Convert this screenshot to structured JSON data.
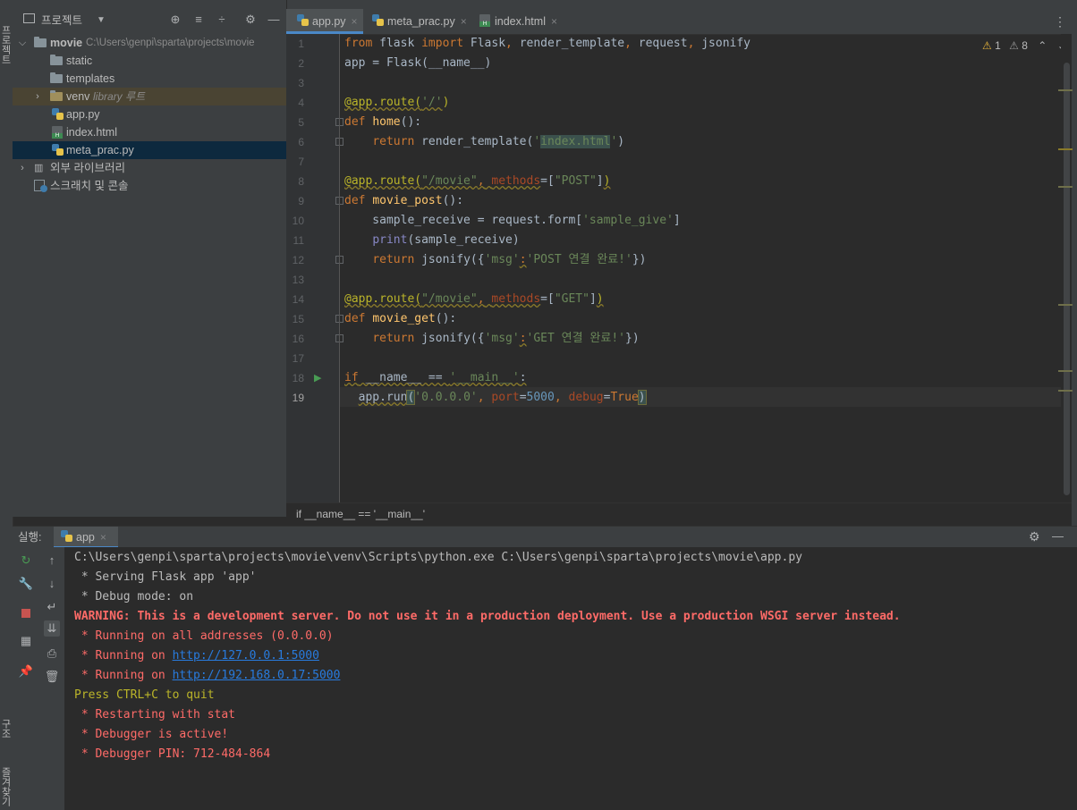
{
  "left_strip": {
    "top_tab": "프로젝트",
    "bottom_tab_1": "구조",
    "bottom_tab_2": "즐겨찾기"
  },
  "project_panel": {
    "title": "프로젝트",
    "tree": [
      {
        "name": "movie",
        "path": "C:\\Users\\genpi\\sparta\\projects\\movie"
      },
      {
        "name": "static"
      },
      {
        "name": "templates"
      },
      {
        "name": "venv",
        "sub": "library 루트"
      },
      {
        "name": "app.py"
      },
      {
        "name": "index.html"
      },
      {
        "name": "meta_prac.py"
      },
      {
        "name": "외부 라이브러리"
      },
      {
        "name": "스크래치 및 콘솔"
      }
    ]
  },
  "editor_tabs": [
    {
      "label": "app.py"
    },
    {
      "label": "meta_prac.py"
    },
    {
      "label": "index.html"
    }
  ],
  "inspections": {
    "warnings": "1",
    "weak_warnings": "8"
  },
  "line_numbers": [
    "1",
    "2",
    "3",
    "4",
    "5",
    "6",
    "7",
    "8",
    "9",
    "10",
    "11",
    "12",
    "13",
    "14",
    "15",
    "16",
    "17",
    "18",
    "19"
  ],
  "breadcrumb": "if __name__ == '__main__'",
  "run_panel": {
    "label": "실행:",
    "tab": "app",
    "output": [
      "C:\\Users\\genpi\\sparta\\projects\\movie\\venv\\Scripts\\python.exe C:\\Users\\genpi\\sparta\\projects\\movie\\app.py",
      " * Serving Flask app 'app'",
      " * Debug mode: on",
      "WARNING: This is a development server. Do not use it in a production deployment. Use a production WSGI server instead.",
      " * Running on all addresses (0.0.0.0)",
      " * Running on ",
      "http://127.0.0.1:5000",
      " * Running on ",
      "http://192.168.0.17:5000",
      "Press CTRL+C to quit",
      " * Restarting with stat",
      " * Debugger is active!",
      " * Debugger PIN: 712-484-864"
    ]
  },
  "colors": {
    "accent": "#4a88c7",
    "error": "#ff6b68",
    "link": "#287bde"
  }
}
